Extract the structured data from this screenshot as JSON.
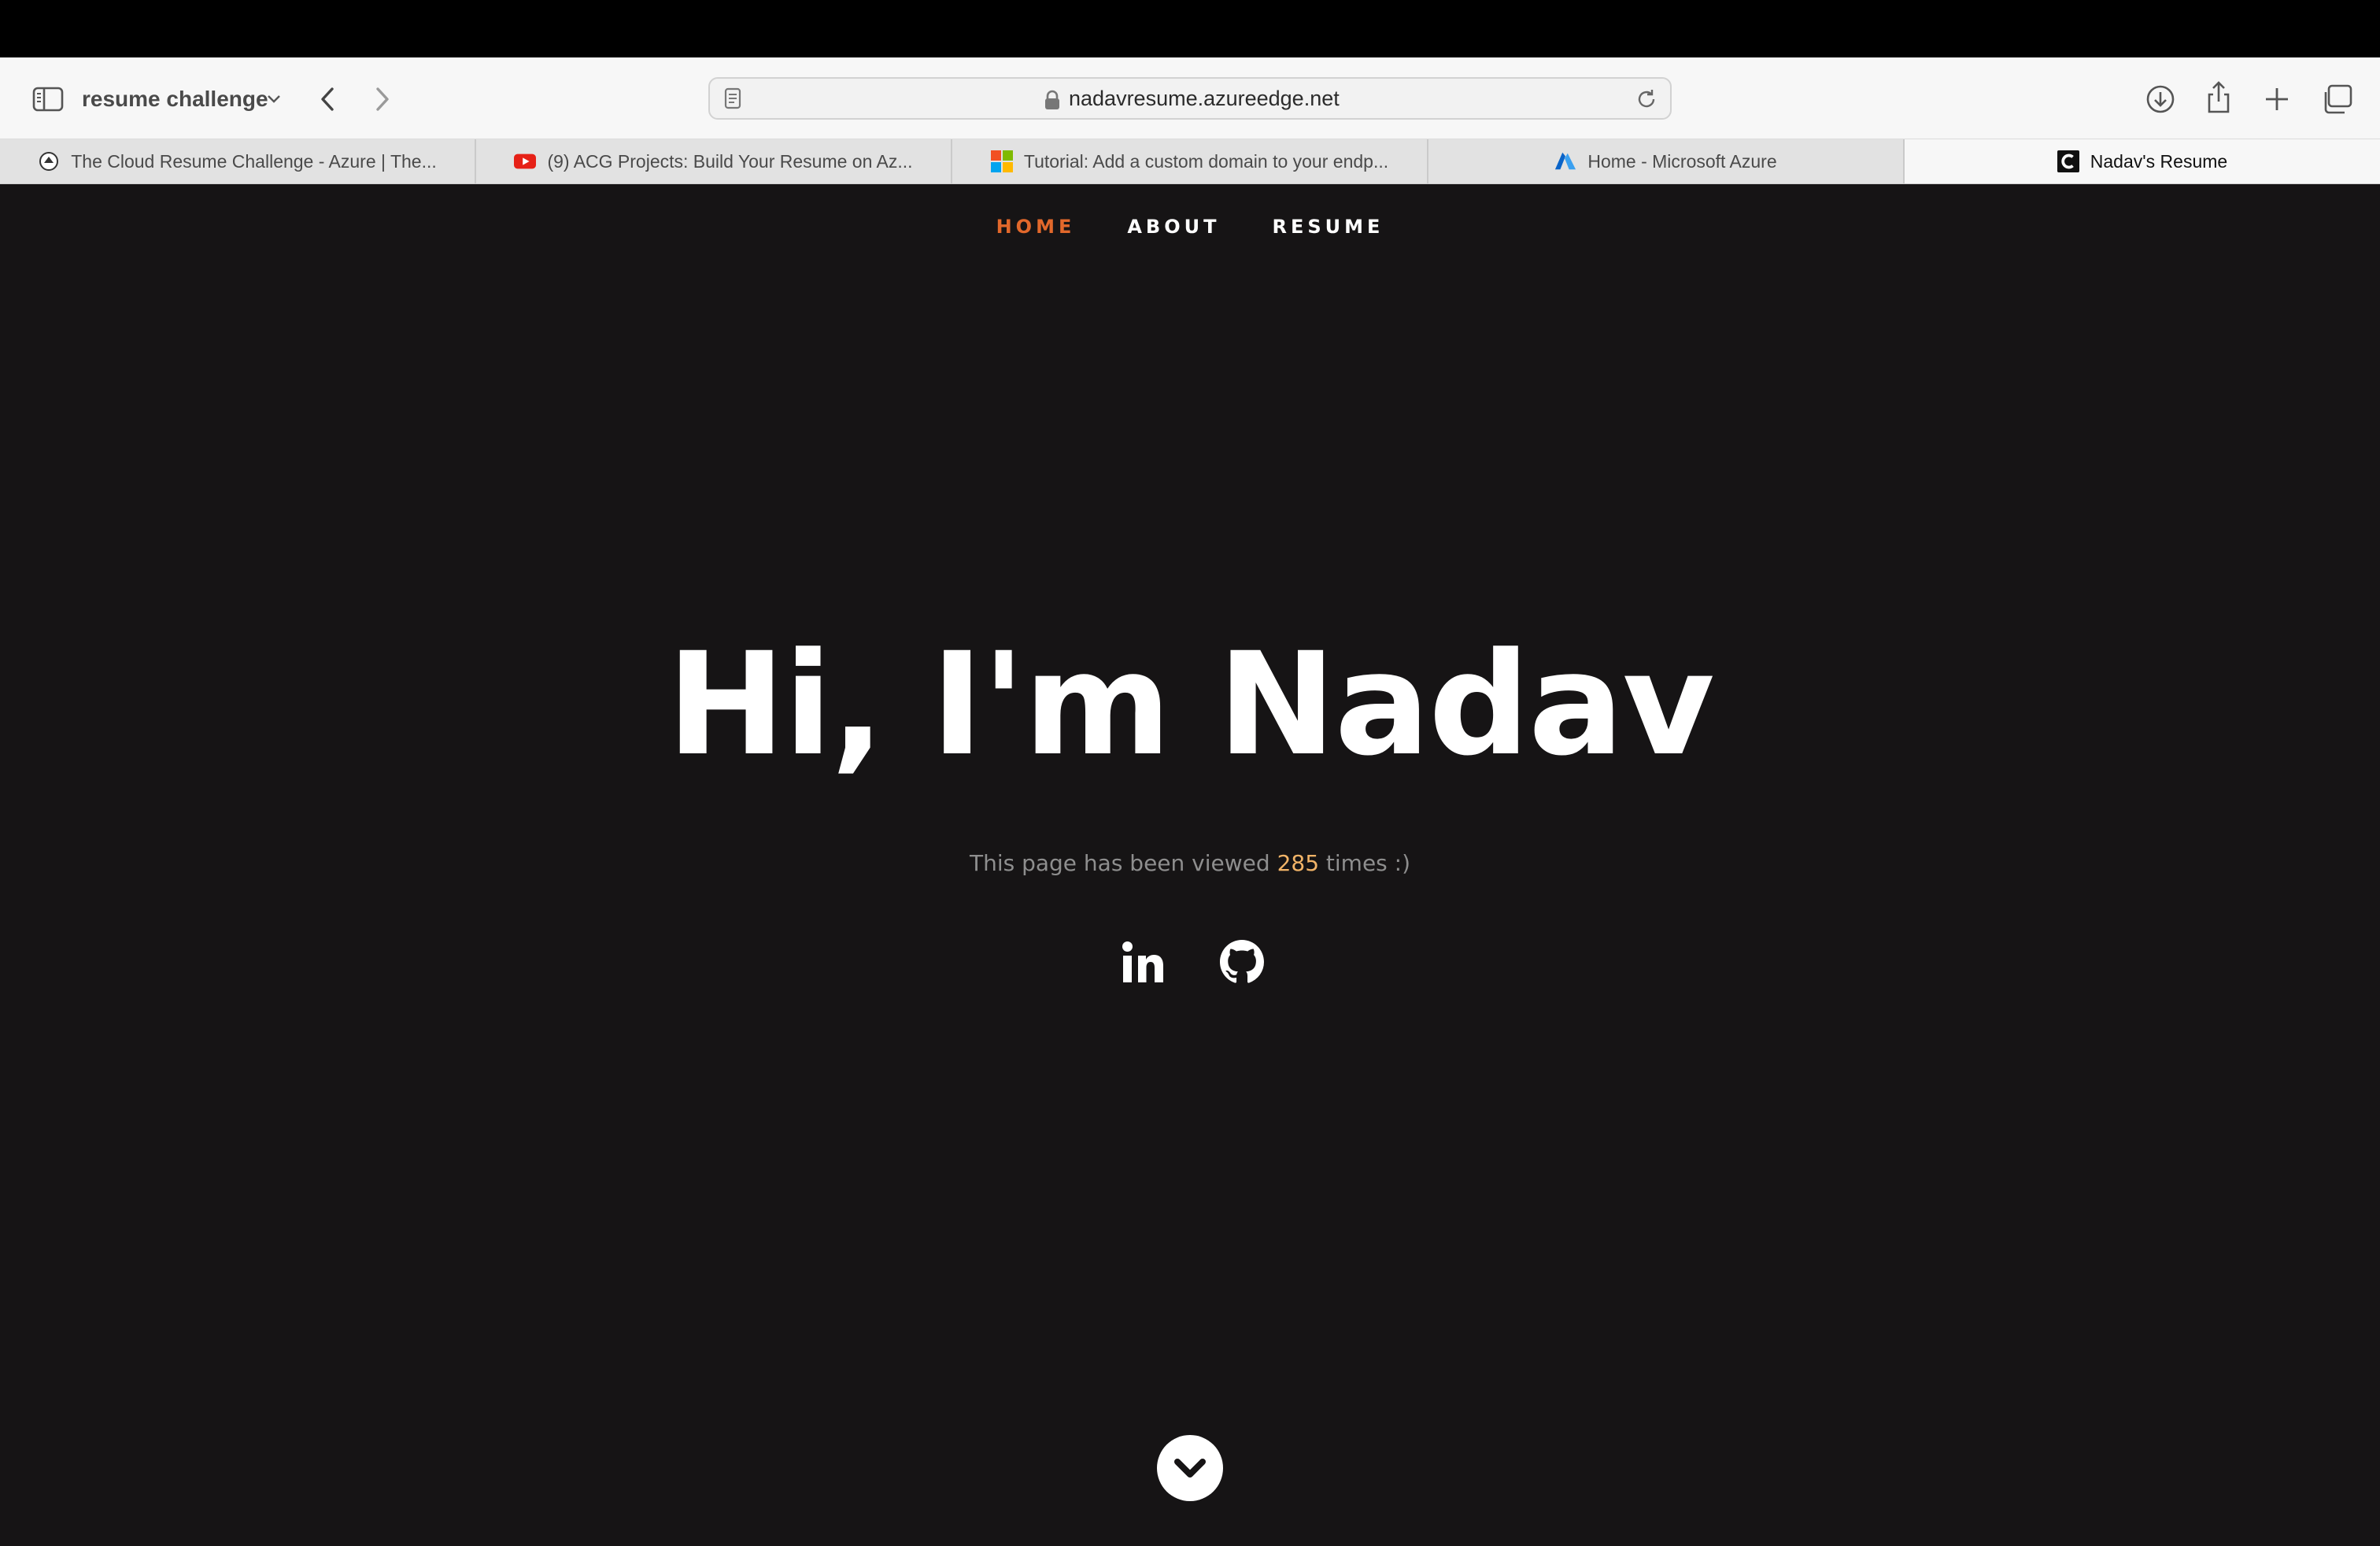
{
  "browser": {
    "tab_group": "resume challenge",
    "url": "nadavresume.azureedge.net",
    "tabs": [
      {
        "title": "The Cloud Resume Challenge - Azure | The...",
        "icon": "cloud-resume-favicon"
      },
      {
        "title": "(9) ACG Projects: Build Your Resume on Az...",
        "icon": "youtube-favicon"
      },
      {
        "title": "Tutorial: Add a custom domain to your endp...",
        "icon": "microsoft-favicon"
      },
      {
        "title": "Home - Microsoft Azure",
        "icon": "azure-favicon"
      },
      {
        "title": "Nadav's Resume",
        "icon": "resume-favicon"
      }
    ]
  },
  "page": {
    "nav": [
      {
        "label": "HOME",
        "active": true
      },
      {
        "label": "ABOUT",
        "active": false
      },
      {
        "label": "RESUME",
        "active": false
      }
    ],
    "hero_title": "Hi, I'm Nadav",
    "views": {
      "prefix": "This page has been viewed ",
      "count": "285",
      "suffix": " times :)"
    },
    "social": [
      "linkedin-icon",
      "github-icon"
    ]
  },
  "colors": {
    "page_background": "#161415",
    "accent": "#e2682b",
    "view_count": "#f2b468"
  }
}
